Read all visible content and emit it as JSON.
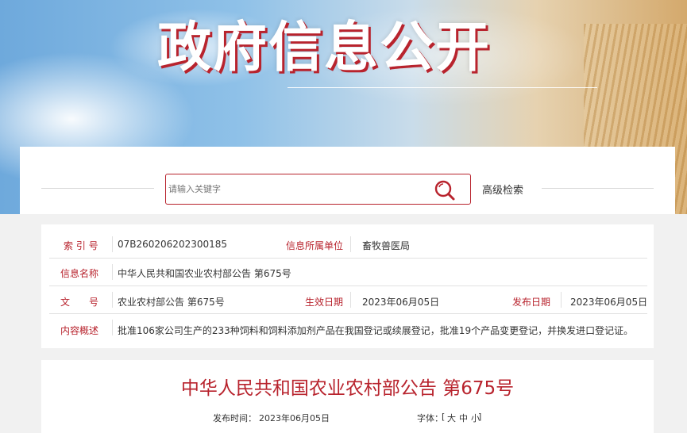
{
  "banner": {
    "title": "政府信息公开"
  },
  "search": {
    "placeholder": "请输入关键字",
    "advanced_label": "高级检索"
  },
  "info": {
    "index_no_label": "索 引 号",
    "index_no_value": "07B260206202300185",
    "unit_label": "信息所属单位",
    "unit_value": "畜牧兽医局",
    "name_label": "信息名称",
    "name_value": "中华人民共和国农业农村部公告 第675号",
    "doc_no_label": "文　　号",
    "doc_no_value": "农业农村部公告 第675号",
    "effective_label": "生效日期",
    "effective_value": "2023年06月05日",
    "publish_label": "发布日期",
    "publish_value": "2023年06月05日",
    "summary_label": "内容概述",
    "summary_value": "批准106家公司生产的233种饲料和饲料添加剂产品在我国登记或续展登记，批准19个产品变更登记，并换发进口登记证。"
  },
  "document": {
    "title": "中华人民共和国农业农村部公告 第675号",
    "publish_time_label": "发布时间：",
    "publish_time_value": "2023年06月05日",
    "font_label": "字体：",
    "font_open": "[",
    "font_large": "大",
    "font_medium": "中",
    "font_small": "小",
    "font_close": "]"
  },
  "colors": {
    "accent": "#b8232d",
    "text": "#333333",
    "panel": "#ffffff",
    "page_bg": "#f1f1f1"
  }
}
